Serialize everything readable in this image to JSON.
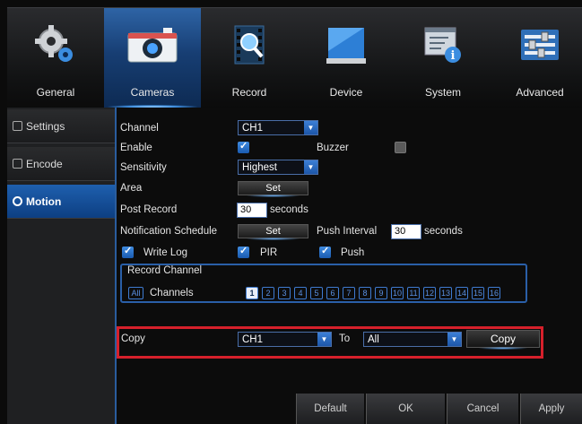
{
  "tabs": [
    {
      "label": "General",
      "icon": "gears-icon"
    },
    {
      "label": "Cameras",
      "icon": "camera-icon"
    },
    {
      "label": "Record",
      "icon": "film-magnifier-icon"
    },
    {
      "label": "Device",
      "icon": "hard-drive-icon"
    },
    {
      "label": "System",
      "icon": "info-window-icon"
    },
    {
      "label": "Advanced",
      "icon": "sliders-icon"
    }
  ],
  "active_tab": "Cameras",
  "sidebar": {
    "items": [
      {
        "label": "Settings",
        "icon": "settings-icon"
      },
      {
        "label": "Encode",
        "icon": "encode-icon"
      },
      {
        "label": "Motion",
        "icon": "motion-icon"
      }
    ],
    "active": "Motion"
  },
  "form": {
    "channel_label": "Channel",
    "channel_value": "CH1",
    "enable_label": "Enable",
    "enable_checked": true,
    "buzzer_label": "Buzzer",
    "buzzer_checked": false,
    "sensitivity_label": "Sensitivity",
    "sensitivity_value": "Highest",
    "area_label": "Area",
    "area_button": "Set",
    "post_record_label": "Post Record",
    "post_record_value": "30",
    "post_record_unit": "seconds",
    "notification_label": "Notification Schedule",
    "notification_button": "Set",
    "push_interval_label": "Push Interval",
    "push_interval_value": "30",
    "push_interval_unit": "seconds",
    "write_log_label": "Write Log",
    "write_log_checked": true,
    "pir_label": "PIR",
    "pir_checked": true,
    "push_label": "Push",
    "push_checked": true
  },
  "record_channel": {
    "title": "Record Channel",
    "all_label": "All",
    "channels_label": "Channels",
    "channels": [
      "1",
      "2",
      "3",
      "4",
      "5",
      "6",
      "7",
      "8",
      "9",
      "10",
      "11",
      "12",
      "13",
      "14",
      "15",
      "16"
    ],
    "selected": [
      "1"
    ]
  },
  "copy": {
    "label": "Copy",
    "from_value": "CH1",
    "to_label": "To",
    "to_value": "All",
    "button": "Copy"
  },
  "buttons": {
    "default": "Default",
    "ok": "OK",
    "cancel": "Cancel",
    "apply": "Apply"
  },
  "colors": {
    "accent": "#1e5fae",
    "highlight_box": "#d6202b"
  }
}
